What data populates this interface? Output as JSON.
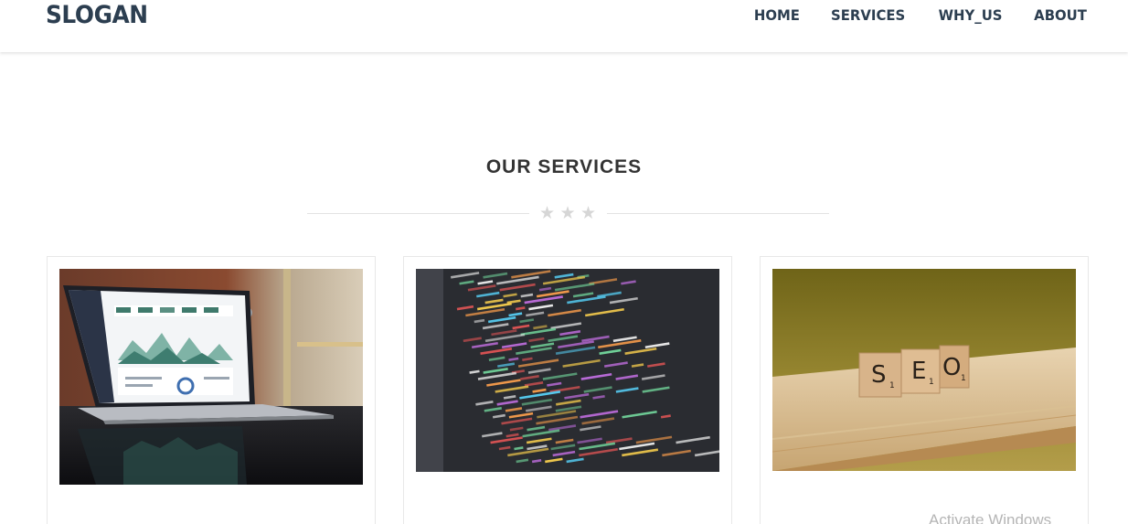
{
  "brand": {
    "logo": "SLOGAN"
  },
  "nav": {
    "items": [
      {
        "label": "HOME"
      },
      {
        "label": "SERVICES"
      },
      {
        "label": "WHY_US"
      },
      {
        "label": "ABOUT"
      }
    ]
  },
  "services": {
    "title": "OUR SERVICES",
    "stars_icon": "star-icon",
    "cards": [
      {
        "image": "laptop-analytics-dashboard-photo"
      },
      {
        "image": "code-editor-screen-photo"
      },
      {
        "image": "seo-scrabble-tiles-photo"
      }
    ]
  },
  "overlay": {
    "watermark": "Activate Windows"
  },
  "colors": {
    "primary": "#2c3e50",
    "title": "#333333",
    "divider": "#e3e3e3",
    "star": "#d6d6d6"
  }
}
